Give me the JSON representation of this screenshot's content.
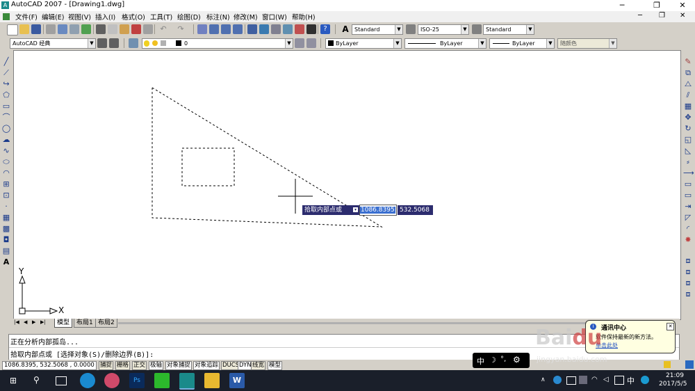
{
  "window": {
    "title": "AutoCAD 2007 - [Drawing1.dwg]",
    "btn_min": "─",
    "btn_restore": "❐",
    "btn_close": "✕"
  },
  "menu": [
    "文件(F)",
    "编辑(E)",
    "视图(V)",
    "插入(I)",
    "格式(O)",
    "工具(T)",
    "绘图(D)",
    "标注(N)",
    "修改(M)",
    "窗口(W)",
    "帮助(H)"
  ],
  "toolbar": {
    "text_style": "Standard",
    "dim_style": "ISO-25",
    "table_style": "Standard",
    "workspace": "AutoCAD 经典",
    "layer": "0",
    "color": "ByLayer",
    "linetype": "ByLayer",
    "lineweight": "ByLayer",
    "plot_style": "随颜色"
  },
  "canvas": {
    "tooltip_prompt": "拾取内部点或",
    "coord_x": "1086.8395",
    "coord_y": "532.5068",
    "ucs_y": "Y",
    "ucs_x": "X"
  },
  "tabs": [
    "模型",
    "布局1",
    "布局2"
  ],
  "command": {
    "line1": "正在分析内部孤岛...",
    "line2": "拾取内部点或 [选择对象(S)/删除边界(B)]:"
  },
  "status": {
    "coords": "1086.8395, 532.5068 , 0.0000",
    "buttons": [
      "捕捉",
      "栅格",
      "正交",
      "极轴",
      "对象捕捉",
      "对象追踪",
      "DUCS",
      "DYN",
      "线宽",
      "模型"
    ]
  },
  "comm_center": {
    "title": "通讯中心",
    "body": "软件保持最新的新方法。",
    "link": "单击此处"
  },
  "ime": {
    "label": "中"
  },
  "tray": {
    "time": "21:09",
    "date": "2017/5/5",
    "ime": "中"
  },
  "watermark": {
    "text": "jingyan.baidu.com"
  }
}
